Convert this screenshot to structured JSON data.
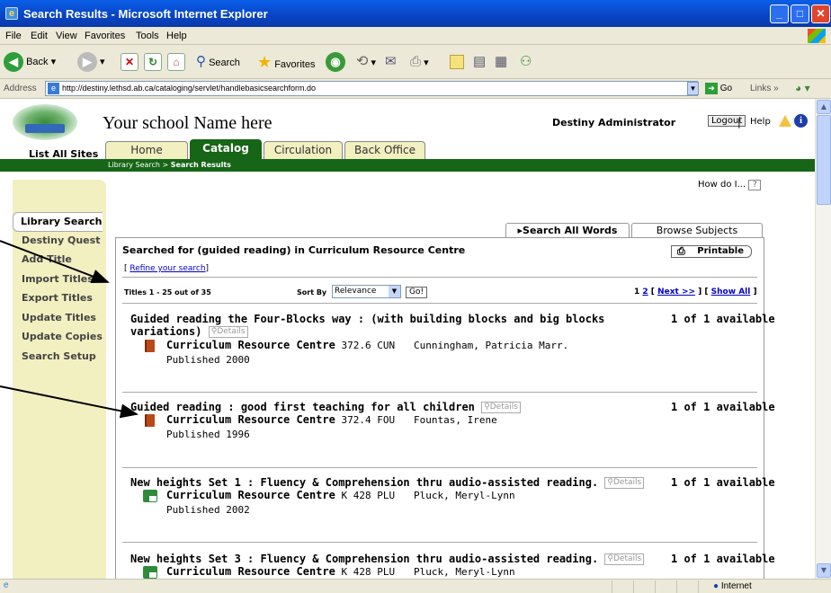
{
  "window": {
    "title": "Search Results - Microsoft Internet Explorer"
  },
  "menu": [
    "File",
    "Edit",
    "View",
    "Favorites",
    "Tools",
    "Help"
  ],
  "toolbar": {
    "back": "Back",
    "search": "Search",
    "favorites": "Favorites"
  },
  "address": {
    "label": "Address",
    "url": "http://destiny.lethsd.ab.ca/cataloging/servlet/handlebasicsearchform.do",
    "go": "Go",
    "links": "Links"
  },
  "header": {
    "site_name": "Your school Name here",
    "user": "Destiny Administrator",
    "logout": "Logout",
    "separator": "|",
    "help": "Help",
    "list_all_sites": "List All Sites"
  },
  "tabs": [
    "Home",
    "Catalog",
    "Circulation",
    "Back Office"
  ],
  "breadcrumb": {
    "parent": "Library Search",
    "current": "Search Results"
  },
  "sidebar": [
    "Library Search",
    "Destiny Quest",
    "Add Title",
    "Import Titles",
    "Export Titles",
    "Update Titles",
    "Update Copies",
    "Search Setup"
  ],
  "how_do_i": "How do I...",
  "how_do_i_icon": "?",
  "search_tabs": {
    "all_words": "Search All Words",
    "browse": "Browse Subjects"
  },
  "results": {
    "searched_for": "Searched for (guided reading) in Curriculum Resource Centre",
    "printable": "Printable",
    "refine": "Refine your search",
    "titles_range": "Titles 1 - 25 out of 35",
    "sort_by_label": "Sort By",
    "sort_by_value": "Relevance",
    "go": "Go!",
    "page_current": "1",
    "page_2": "2",
    "next": "Next >>",
    "show_all": "Show All",
    "details_label": "Details",
    "items": [
      {
        "title": "Guided reading the Four-Blocks way : (with building blocks and big blocks",
        "title2": "variations)",
        "availability": "1 of 1 available",
        "location": "Curriculum Resource Centre",
        "call_no": "372.6 CUN",
        "author": "Cunningham, Patricia Marr.",
        "published": "Published 2000",
        "icon": "book-icon"
      },
      {
        "title": "Guided reading : good first teaching for all children",
        "availability": "1 of 1 available",
        "location": "Curriculum Resource Centre",
        "call_no": "372.4 FOU",
        "author": "Fountas, Irene",
        "published": "Published 1996",
        "icon": "book-icon"
      },
      {
        "title": "New heights Set 1 : Fluency & Comprehension thru audio-assisted reading.",
        "availability": "1 of 1 available",
        "location": "Curriculum Resource Centre",
        "call_no": "K 428 PLU",
        "author": "Pluck, Meryl-Lynn",
        "published": "Published 2002",
        "icon": "media-icon"
      },
      {
        "title": "New heights Set 3 : Fluency & Comprehension thru audio-assisted reading.",
        "availability": "1 of 1 available",
        "location": "Curriculum Resource Centre",
        "call_no": "K 428 PLU",
        "author": "Pluck, Meryl-Lynn",
        "icon": "media-icon"
      }
    ]
  },
  "status": {
    "zone": "Internet"
  },
  "colors": {
    "brand_green": "#176517",
    "tab_yellow": "#f2efc0",
    "xp_blue": "#0a5ee8"
  }
}
